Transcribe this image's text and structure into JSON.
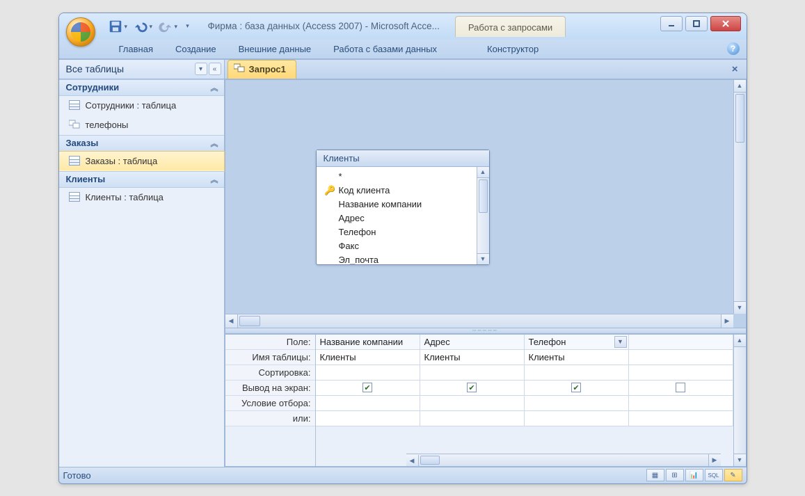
{
  "window": {
    "title": "Фирма : база данных (Access 2007)  -  Microsoft Acce...",
    "context_tab": "Работа с запросами"
  },
  "qat": {
    "save": "save",
    "undo": "undo",
    "redo": "redo"
  },
  "ribbon": {
    "tabs": [
      "Главная",
      "Создание",
      "Внешние данные",
      "Работа с базами данных",
      "Конструктор"
    ]
  },
  "nav": {
    "title": "Все таблицы",
    "groups": [
      {
        "name": "Сотрудники",
        "items": [
          {
            "label": "Сотрудники : таблица",
            "icon": "table"
          },
          {
            "label": "телефоны",
            "icon": "query"
          }
        ]
      },
      {
        "name": "Заказы",
        "items": [
          {
            "label": "Заказы : таблица",
            "icon": "table",
            "selected": true
          }
        ]
      },
      {
        "name": "Клиенты",
        "items": [
          {
            "label": "Клиенты : таблица",
            "icon": "table"
          }
        ]
      }
    ]
  },
  "document": {
    "tab_label": "Запрос1",
    "fieldbox": {
      "title": "Клиенты",
      "fields": [
        "*",
        "Код клиента",
        "Название компании",
        "Адрес",
        "Телефон",
        "Факс",
        "Эл_почта"
      ],
      "key_field_index": 1
    }
  },
  "qbe": {
    "row_labels": [
      "Поле:",
      "Имя таблицы:",
      "Сортировка:",
      "Вывод на экран:",
      "Условие отбора:",
      "или:"
    ],
    "columns": [
      {
        "field": "Название компании",
        "table": "Клиенты",
        "sort": "",
        "show": true,
        "criteria": "",
        "or": ""
      },
      {
        "field": "Адрес",
        "table": "Клиенты",
        "sort": "",
        "show": true,
        "criteria": "",
        "or": ""
      },
      {
        "field": "Телефон",
        "table": "Клиенты",
        "sort": "",
        "show": true,
        "criteria": "",
        "or": "",
        "dropdown": true
      }
    ]
  },
  "status": {
    "text": "Готово",
    "views": [
      "datasheet",
      "pivot-table",
      "pivot-chart",
      "sql",
      "design"
    ]
  }
}
